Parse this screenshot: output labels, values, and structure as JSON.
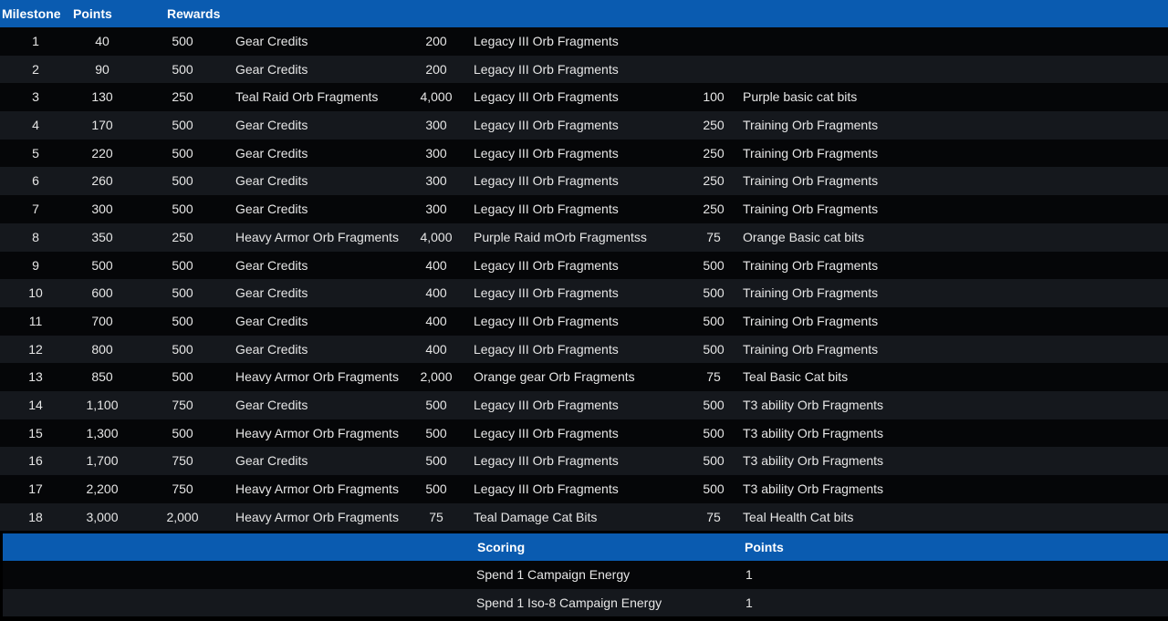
{
  "header": {
    "milestone": "Milestone",
    "points": "Points",
    "rewards": "Rewards"
  },
  "milestones": [
    {
      "milestone": "1",
      "points": "40",
      "r1_qty": "500",
      "r1_name": "Gear Credits",
      "r2_qty": "200",
      "r2_name": "Legacy III Orb Fragments",
      "r3_qty": "",
      "r3_name": ""
    },
    {
      "milestone": "2",
      "points": "90",
      "r1_qty": "500",
      "r1_name": "Gear Credits",
      "r2_qty": "200",
      "r2_name": "Legacy III Orb Fragments",
      "r3_qty": "",
      "r3_name": ""
    },
    {
      "milestone": "3",
      "points": "130",
      "r1_qty": "250",
      "r1_name": "Teal Raid Orb Fragments",
      "r2_qty": "4,000",
      "r2_name": "Legacy III Orb Fragments",
      "r3_qty": "100",
      "r3_name": "Purple basic cat bits"
    },
    {
      "milestone": "4",
      "points": "170",
      "r1_qty": "500",
      "r1_name": "Gear Credits",
      "r2_qty": "300",
      "r2_name": "Legacy III Orb Fragments",
      "r3_qty": "250",
      "r3_name": "Training Orb Fragments"
    },
    {
      "milestone": "5",
      "points": "220",
      "r1_qty": "500",
      "r1_name": "Gear Credits",
      "r2_qty": "300",
      "r2_name": "Legacy III Orb Fragments",
      "r3_qty": "250",
      "r3_name": "Training Orb Fragments"
    },
    {
      "milestone": "6",
      "points": "260",
      "r1_qty": "500",
      "r1_name": "Gear Credits",
      "r2_qty": "300",
      "r2_name": "Legacy III Orb Fragments",
      "r3_qty": "250",
      "r3_name": "Training Orb Fragments"
    },
    {
      "milestone": "7",
      "points": "300",
      "r1_qty": "500",
      "r1_name": "Gear Credits",
      "r2_qty": "300",
      "r2_name": "Legacy III Orb Fragments",
      "r3_qty": "250",
      "r3_name": "Training Orb Fragments"
    },
    {
      "milestone": "8",
      "points": "350",
      "r1_qty": "250",
      "r1_name": "Heavy Armor Orb Fragments",
      "r2_qty": "4,000",
      "r2_name": "Purple Raid mOrb Fragmentss",
      "r3_qty": "75",
      "r3_name": "Orange Basic cat bits"
    },
    {
      "milestone": "9",
      "points": "500",
      "r1_qty": "500",
      "r1_name": "Gear Credits",
      "r2_qty": "400",
      "r2_name": "Legacy III Orb Fragments",
      "r3_qty": "500",
      "r3_name": "Training Orb Fragments"
    },
    {
      "milestone": "10",
      "points": "600",
      "r1_qty": "500",
      "r1_name": "Gear Credits",
      "r2_qty": "400",
      "r2_name": "Legacy III Orb Fragments",
      "r3_qty": "500",
      "r3_name": "Training Orb Fragments"
    },
    {
      "milestone": "11",
      "points": "700",
      "r1_qty": "500",
      "r1_name": "Gear Credits",
      "r2_qty": "400",
      "r2_name": "Legacy III Orb Fragments",
      "r3_qty": "500",
      "r3_name": "Training Orb Fragments"
    },
    {
      "milestone": "12",
      "points": "800",
      "r1_qty": "500",
      "r1_name": "Gear Credits",
      "r2_qty": "400",
      "r2_name": "Legacy III Orb Fragments",
      "r3_qty": "500",
      "r3_name": "Training Orb Fragments"
    },
    {
      "milestone": "13",
      "points": "850",
      "r1_qty": "500",
      "r1_name": "Heavy Armor Orb Fragments",
      "r2_qty": "2,000",
      "r2_name": "Orange gear Orb Fragments",
      "r3_qty": "75",
      "r3_name": "Teal Basic Cat bits"
    },
    {
      "milestone": "14",
      "points": "1,100",
      "r1_qty": "750",
      "r1_name": "Gear Credits",
      "r2_qty": "500",
      "r2_name": "Legacy III Orb Fragments",
      "r3_qty": "500",
      "r3_name": "T3 ability Orb Fragments"
    },
    {
      "milestone": "15",
      "points": "1,300",
      "r1_qty": "500",
      "r1_name": "Heavy Armor Orb Fragments",
      "r2_qty": "500",
      "r2_name": "Legacy III Orb Fragments",
      "r3_qty": "500",
      "r3_name": "T3 ability Orb Fragments"
    },
    {
      "milestone": "16",
      "points": "1,700",
      "r1_qty": "750",
      "r1_name": "Gear Credits",
      "r2_qty": "500",
      "r2_name": "Legacy III Orb Fragments",
      "r3_qty": "500",
      "r3_name": "T3 ability Orb Fragments"
    },
    {
      "milestone": "17",
      "points": "2,200",
      "r1_qty": "750",
      "r1_name": "Heavy Armor Orb Fragments",
      "r2_qty": "500",
      "r2_name": "Legacy III Orb Fragments",
      "r3_qty": "500",
      "r3_name": "T3 ability Orb Fragments"
    },
    {
      "milestone": "18",
      "points": "3,000",
      "r1_qty": "2,000",
      "r1_name": "Heavy Armor Orb Fragments",
      "r2_qty": "75",
      "r2_name": "Teal Damage Cat Bits",
      "r3_qty": "75",
      "r3_name": "Teal Health Cat bits"
    }
  ],
  "scoring": {
    "header": {
      "scoring": "Scoring",
      "points": "Points"
    },
    "rows": [
      {
        "name": "Spend 1 Campaign Energy",
        "points": "1"
      },
      {
        "name": "Spend 1 Iso-8 Campaign Energy",
        "points": "1"
      }
    ]
  },
  "colors": {
    "header_bg": "#0a5bb0",
    "row_dark": "#050608",
    "row_light": "#15181d"
  }
}
